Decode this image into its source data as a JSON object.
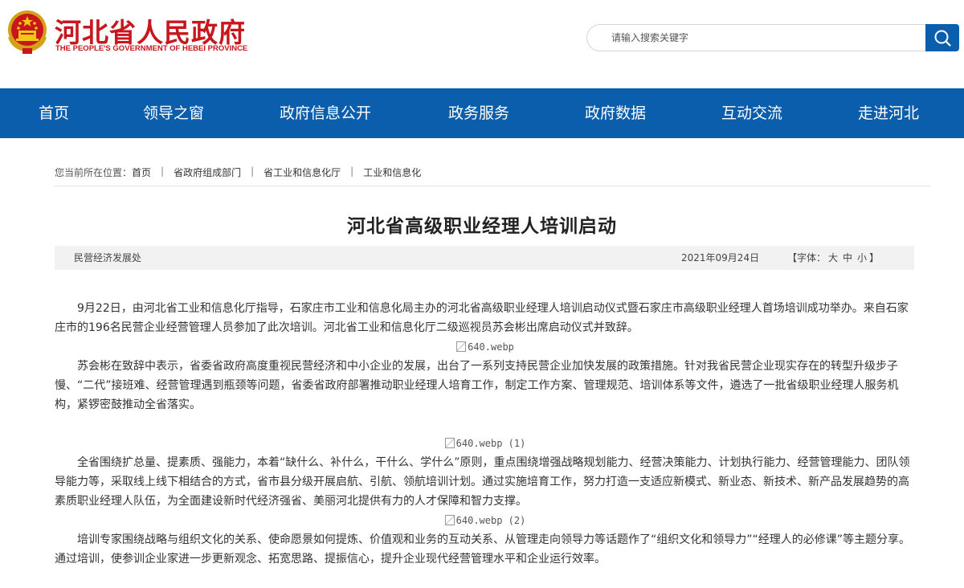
{
  "header": {
    "site_title": "河北省人民政府",
    "site_subtitle": "THE PEOPLE'S GOVERNMENT OF HEBEI PROVINCE",
    "search_placeholder": "请输入搜索关键字",
    "colors": {
      "brand_red": "#c8161d",
      "nav_blue": "#0b5eab"
    }
  },
  "nav": {
    "items": [
      "首页",
      "领导之窗",
      "政府信息公开",
      "政务服务",
      "政府数据",
      "互动交流",
      "走进河北"
    ]
  },
  "breadcrumb": {
    "prefix": "您当前所在位置：",
    "items": [
      "首页",
      "省政府组成部门",
      "省工业和信息化厅",
      "工业和信息化"
    ],
    "separator": "|"
  },
  "article": {
    "title": "河北省高级职业经理人培训启动",
    "source": "民营经济发展处",
    "date": "2021年09月24日",
    "font_size": {
      "prefix": "【字体：",
      "large": "大",
      "medium": "中",
      "small": "小",
      "suffix": "】"
    },
    "paragraphs": [
      "9月22日，由河北省工业和信息化厅指导，石家庄市工业和信息化局主办的河北省高级职业经理人培训启动仪式暨石家庄市高级职业经理人首场培训成功举办。来自石家庄市的196名民营企业经营管理人员参加了此次培训。河北省工业和信息化厅二级巡视员苏会彬出席启动仪式并致辞。",
      "苏会彬在致辞中表示，省委省政府高度重视民营经济和中小企业的发展，出台了一系列支持民营企业加快发展的政策措施。针对我省民营企业现实存在的转型升级步子慢、“二代”接班难、经营管理遇到瓶颈等问题，省委省政府部署推动职业经理人培育工作，制定工作方案、管理规范、培训体系等文件，遴选了一批省级职业经理人服务机构，紧锣密鼓推动全省落实。",
      "全省围绕扩总量、提素质、强能力，本着“缺什么、补什么，干什么、学什么”原则，重点围绕增强战略规划能力、经营决策能力、计划执行能力、经营管理能力、团队领导能力等，采取线上线下相结合的方式，省市县分级开展启航、引航、领航培训计划。通过实施培育工作，努力打造一支适应新模式、新业态、新技术、新产品发展趋势的高素质职业经理人队伍，为全面建设新时代经济强省、美丽河北提供有力的人才保障和智力支撑。",
      "培训专家围绕战略与组织文化的关系、使命愿景如何提炼、价值观和业务的互动关系、从管理走向领导力等话题作了“组织文化和领导力”“经理人的必修课”等主题分享。通过培训，使参训企业家进一步更新观念、拓宽思路、提振信心，提升企业现代经营管理水平和企业运行效率。"
    ],
    "images": [
      "640.webp",
      "640.webp (1)",
      "640.webp (2)"
    ]
  }
}
